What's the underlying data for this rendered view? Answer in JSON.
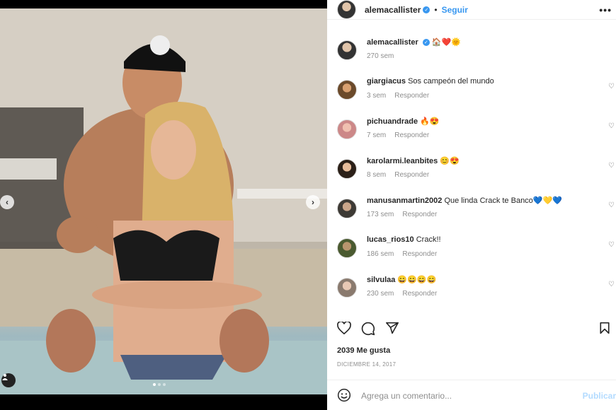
{
  "post": {
    "author": "alemacallister",
    "follow_label": "Seguir",
    "more_label": "•••",
    "caption_emojis": "🏠❤️🌞",
    "caption_time": "270 sem",
    "carousel": {
      "prev": "‹",
      "next": "›"
    }
  },
  "comments": [
    {
      "user": "giargiacus",
      "text": "Sos campeón del mundo",
      "time": "3 sem",
      "reply": "Responder"
    },
    {
      "user": "pichuandrade",
      "text": "🔥😍",
      "time": "7 sem",
      "reply": "Responder"
    },
    {
      "user": "karolarmi.leanbites",
      "text": "😊😍",
      "time": "8 sem",
      "reply": "Responder"
    },
    {
      "user": "manusanmartin2002",
      "text": "Que linda Crack te Banco💙💛💙",
      "time": "173 sem",
      "reply": "Responder"
    },
    {
      "user": "lucas_rios10",
      "text": "Crack!!",
      "time": "186 sem",
      "reply": "Responder"
    },
    {
      "user": "silvulaa",
      "text": "😄😄😄😄",
      "time": "230 sem",
      "reply": "Responder"
    }
  ],
  "likes": "2039 Me gusta",
  "date": "DICIEMBRE 14, 2017",
  "add_comment": {
    "placeholder": "Agrega un comentario...",
    "publish": "Publicar"
  },
  "colors": {
    "accent": "#3897f0",
    "text": "#262626",
    "muted": "#8e8e8e"
  }
}
